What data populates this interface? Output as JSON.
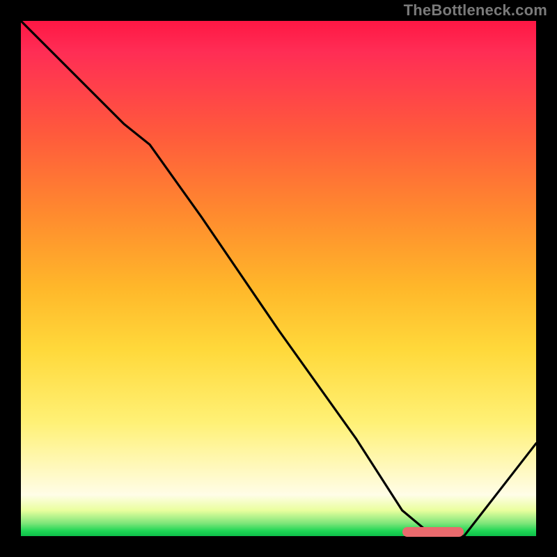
{
  "watermark": "TheBottleneck.com",
  "colors": {
    "axis": "#000000",
    "curve": "#000000",
    "pill": "#e96a6d",
    "gradient_top": "#ff1744",
    "gradient_bottom": "#0dbf4a"
  },
  "chart_data": {
    "type": "line",
    "title": "",
    "xlabel": "",
    "ylabel": "",
    "xlim": [
      0,
      1
    ],
    "ylim": [
      0,
      1
    ],
    "grid": false,
    "legend": false,
    "series": [
      {
        "name": "bottleneck-curve",
        "x": [
          0.0,
          0.1,
          0.2,
          0.25,
          0.35,
          0.5,
          0.65,
          0.74,
          0.8,
          0.86,
          1.0
        ],
        "y": [
          1.0,
          0.9,
          0.8,
          0.76,
          0.62,
          0.4,
          0.19,
          0.05,
          0.0,
          0.0,
          0.18
        ]
      }
    ],
    "marker": {
      "name": "optimal-range",
      "x_start": 0.74,
      "x_end": 0.86,
      "y": 0.005
    }
  }
}
